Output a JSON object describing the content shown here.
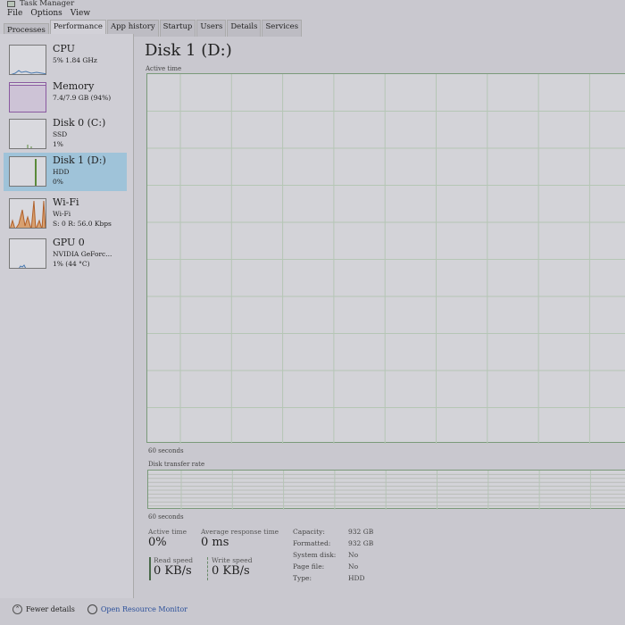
{
  "window": {
    "title": "Task Manager"
  },
  "menu": [
    "File",
    "Options",
    "View"
  ],
  "tabs": [
    "Processes",
    "Performance",
    "App history",
    "Startup",
    "Users",
    "Details",
    "Services"
  ],
  "sidebar": [
    {
      "name": "CPU",
      "sub1": "5% 1.84 GHz",
      "sub2": "",
      "sub3": "",
      "color": "#4a7ab0"
    },
    {
      "name": "Memory",
      "sub1": "7.4/7.9 GB (94%)",
      "sub2": "",
      "sub3": "",
      "color": "#8a5aa0"
    },
    {
      "name": "Disk 0 (C:)",
      "sub1": "SSD",
      "sub2": "1%",
      "sub3": "",
      "color": "#5a8a3a"
    },
    {
      "name": "Disk 1 (D:)",
      "sub1": "HDD",
      "sub2": "0%",
      "sub3": "",
      "color": "#5a8a3a"
    },
    {
      "name": "Wi-Fi",
      "sub1": "Wi-Fi",
      "sub2": "S: 0 R: 56.0 Kbps",
      "sub3": "",
      "color": "#b0602a"
    },
    {
      "name": "GPU 0",
      "sub1": "NVIDIA GeForc...",
      "sub2": "1% (44 °C)",
      "sub3": "",
      "color": "#4a7ab0"
    }
  ],
  "main": {
    "title": "Disk 1 (D:)",
    "graph1_label": "Active time",
    "graph1_time": "60 seconds",
    "graph2_label": "Disk transfer rate",
    "graph2_time": "60 seconds",
    "stats": {
      "active_time_label": "Active time",
      "active_time": "0%",
      "resp_label": "Average response time",
      "resp": "0 ms",
      "read_label": "Read speed",
      "read": "0 KB/s",
      "write_label": "Write speed",
      "write": "0 KB/s"
    },
    "props": [
      {
        "k": "Capacity:",
        "v": "932 GB"
      },
      {
        "k": "Formatted:",
        "v": "932 GB"
      },
      {
        "k": "System disk:",
        "v": "No"
      },
      {
        "k": "Page file:",
        "v": "No"
      },
      {
        "k": "Type:",
        "v": "HDD"
      }
    ]
  },
  "footer": {
    "fewer": "Fewer details",
    "monitor": "Open Resource Monitor"
  }
}
